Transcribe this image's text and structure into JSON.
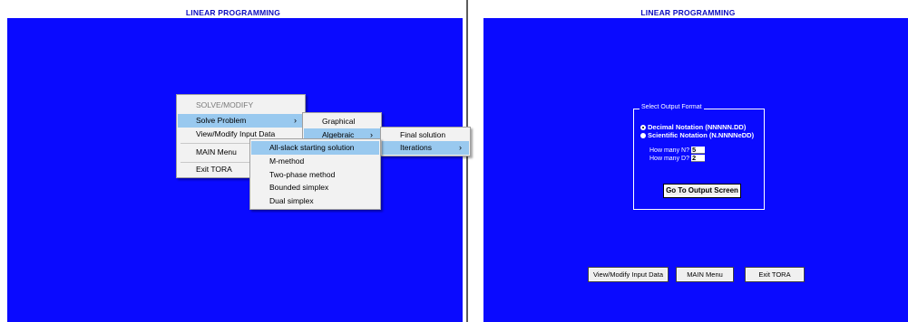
{
  "app_title": "LINEAR PROGRAMMING",
  "menu": {
    "header": "SOLVE/MODIFY",
    "items": [
      "Solve Problem",
      "View/Modify Input Data",
      "MAIN Menu",
      "Exit TORA"
    ]
  },
  "submenu_method": {
    "items": [
      "Graphical",
      "Algebraic"
    ]
  },
  "submenu_output": {
    "items": [
      "Final solution",
      "Iterations"
    ]
  },
  "submenu_start": {
    "items": [
      "All-slack starting solution",
      "M-method",
      "Two-phase method",
      "Bounded simplex",
      "Dual simplex"
    ]
  },
  "output_format": {
    "legend": "Select Output Format",
    "option1": "Decimal Notation (NNNNN.DD)",
    "option2": "Scientific Notation (N.NNNNeDD)",
    "n_label": "How many N?",
    "n_value": "5",
    "d_label": "How many D?",
    "d_value": "2",
    "go_button": "Go To Output Screen"
  },
  "bottom_buttons": [
    "View/Modify Input Data",
    "MAIN Menu",
    "Exit TORA"
  ],
  "colors": {
    "background": "#0a0aff",
    "menu_highlight": "#99c9ef",
    "title": "#0b0bbf"
  }
}
